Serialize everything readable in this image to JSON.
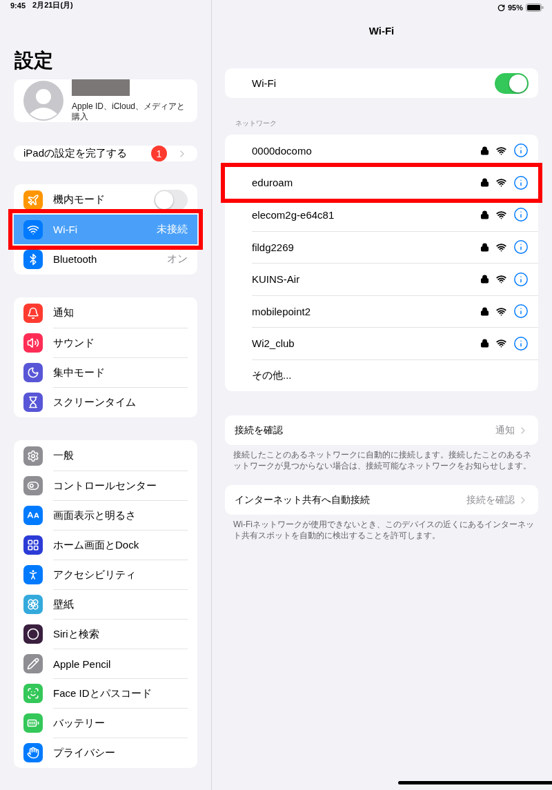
{
  "status_bar": {
    "time": "9:45",
    "date": "2月21日(月)",
    "battery": "95%"
  },
  "sidebar": {
    "title": "設定",
    "profile": {
      "subtitle": "Apple ID、iCloud、メディアと購入"
    },
    "setup": {
      "label": "iPadの設定を完了する",
      "badge": "1"
    },
    "groups": [
      {
        "items": [
          {
            "label": "機内モード",
            "kind": "toggle",
            "on": false,
            "selected": false,
            "annotated": false,
            "color": "#ff9500"
          },
          {
            "label": "Wi-Fi",
            "kind": "value",
            "value": "未接続",
            "selected": true,
            "annotated": true,
            "color": "#007aff"
          },
          {
            "label": "Bluetooth",
            "kind": "value",
            "value": "オン",
            "selected": false,
            "annotated": false,
            "color": "#007aff"
          }
        ]
      },
      {
        "items": [
          {
            "label": "通知",
            "kind": "link",
            "selected": false,
            "annotated": false,
            "color": "#ff3b30"
          },
          {
            "label": "サウンド",
            "kind": "link",
            "selected": false,
            "annotated": false,
            "color": "#ff2d55"
          },
          {
            "label": "集中モード",
            "kind": "link",
            "selected": false,
            "annotated": false,
            "color": "#5856d6"
          },
          {
            "label": "スクリーンタイム",
            "kind": "link",
            "selected": false,
            "annotated": false,
            "color": "#5856d6"
          }
        ]
      },
      {
        "items": [
          {
            "label": "一般",
            "kind": "link",
            "selected": false,
            "annotated": false,
            "color": "#8e8e93"
          },
          {
            "label": "コントロールセンター",
            "kind": "link",
            "selected": false,
            "annotated": false,
            "color": "#8e8e93"
          },
          {
            "label": "画面表示と明るさ",
            "kind": "link",
            "selected": false,
            "annotated": false,
            "color": "#007aff"
          },
          {
            "label": "ホーム画面とDock",
            "kind": "link",
            "selected": false,
            "annotated": false,
            "color": "#2c3bd6"
          },
          {
            "label": "アクセシビリティ",
            "kind": "link",
            "selected": false,
            "annotated": false,
            "color": "#007aff"
          },
          {
            "label": "壁紙",
            "kind": "link",
            "selected": false,
            "annotated": false,
            "color": "#34aadc"
          },
          {
            "label": "Siriと検索",
            "kind": "link",
            "selected": false,
            "annotated": false,
            "color": "#3a1f3f"
          },
          {
            "label": "Apple Pencil",
            "kind": "link",
            "selected": false,
            "annotated": false,
            "color": "#8e8e93"
          },
          {
            "label": "Face IDとパスコード",
            "kind": "link",
            "selected": false,
            "annotated": false,
            "color": "#34c759"
          },
          {
            "label": "バッテリー",
            "kind": "link",
            "selected": false,
            "annotated": false,
            "color": "#34c759"
          },
          {
            "label": "プライバシー",
            "kind": "link",
            "selected": false,
            "annotated": false,
            "color": "#007aff"
          }
        ]
      }
    ]
  },
  "detail": {
    "title": "Wi-Fi",
    "wifi": {
      "label": "Wi-Fi",
      "on": true
    },
    "section_header": "ネットワーク",
    "networks": [
      {
        "name": "0000docomo",
        "kind": "network",
        "locked": true,
        "annotated": false
      },
      {
        "name": "eduroam",
        "kind": "network",
        "locked": true,
        "annotated": true
      },
      {
        "name": "elecom2g-e64c81",
        "kind": "network",
        "locked": true,
        "annotated": false
      },
      {
        "name": "fildg2269",
        "kind": "network",
        "locked": true,
        "annotated": false
      },
      {
        "name": "KUINS-Air",
        "kind": "network",
        "locked": true,
        "annotated": false
      },
      {
        "name": "mobilepoint2",
        "kind": "network",
        "locked": true,
        "annotated": false
      },
      {
        "name": "Wi2_club",
        "kind": "network",
        "locked": true,
        "annotated": false
      },
      {
        "name": "その他...",
        "kind": "other",
        "annotated": false
      }
    ],
    "options": [
      {
        "label": "接続を確認",
        "value": "通知",
        "note": "接続したことのあるネットワークに自動的に接続します。接続したことのあるネットワークが見つからない場合は、接続可能なネットワークをお知らせします。"
      },
      {
        "label": "インターネット共有へ自動接続",
        "value": "接続を確認",
        "note": "Wi-Fiネットワークが使用できないとき、このデバイスの近くにあるインターネット共有スポットを自動的に検出することを許可します。"
      }
    ]
  }
}
